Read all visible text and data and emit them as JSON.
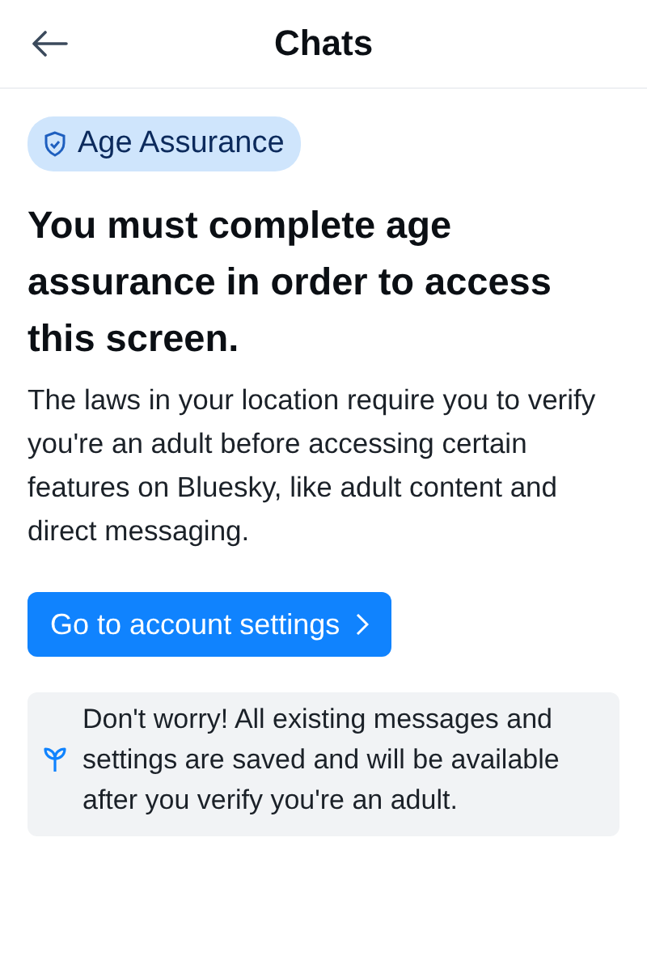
{
  "header": {
    "title": "Chats"
  },
  "badge": {
    "label": "Age Assurance"
  },
  "heading": "You must complete age assurance in order to access this screen.",
  "body": "The laws in your location require you to verify you're an adult before accessing certain features on Bluesky, like adult content and direct messaging.",
  "button": {
    "label": "Go to account settings"
  },
  "note": {
    "text": "Don't worry! All existing messages and settings are saved and will be available after you verify you're an adult."
  }
}
